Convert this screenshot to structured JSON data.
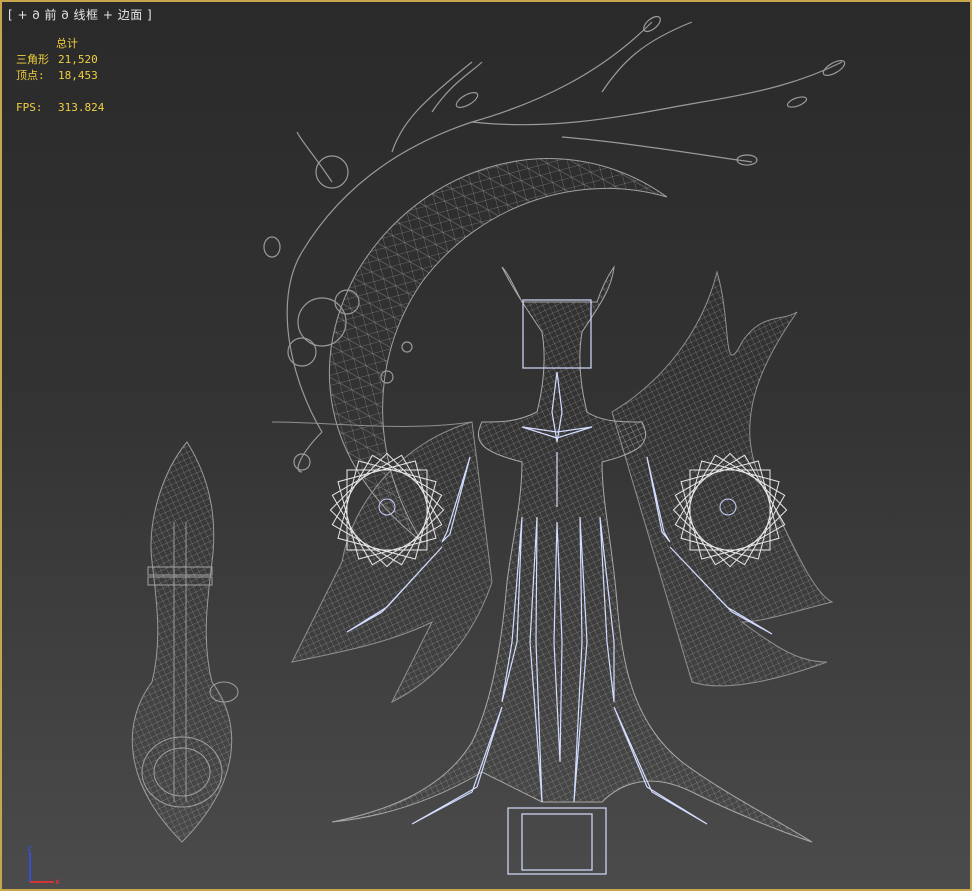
{
  "viewport": {
    "label": "[ + 𐐀 前 𐐀 线框 + 边面 ]",
    "stats": {
      "header": "总计",
      "triangles_label": "三角形",
      "triangles_value": "21,520",
      "vertices_label": "顶点:",
      "vertices_value": "18,453",
      "fps_label": "FPS:",
      "fps_value": "313.824"
    },
    "axis": {
      "z": "z",
      "x": "x"
    }
  },
  "colors": {
    "frame": "#c8a64b",
    "stats_text": "#f0d040",
    "wire": "#9a9a9a",
    "bones": "#cfd8ff",
    "axis_z": "#3050ff",
    "axis_x": "#ff3030"
  }
}
